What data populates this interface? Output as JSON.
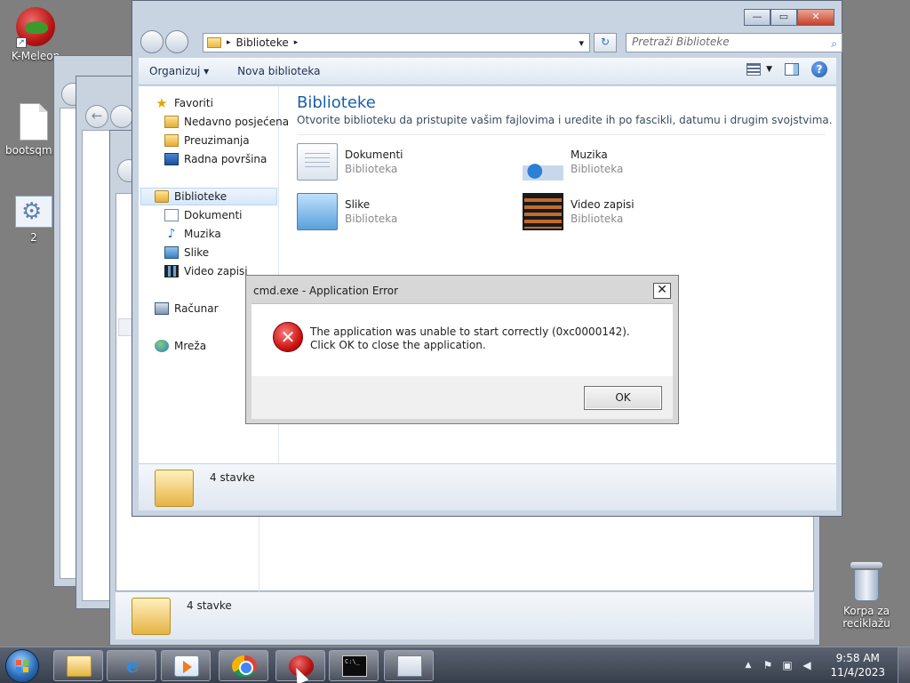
{
  "desktop": {
    "icons": [
      {
        "label": "K-Meleon",
        "icon": "k-meleon-icon"
      },
      {
        "label": "bootsqm.d",
        "icon": "file-icon"
      },
      {
        "label": "2",
        "icon": "setup-icon"
      }
    ],
    "recycle_bin": {
      "label_line1": "Korpa za",
      "label_line2": "reciklažu",
      "icon": "recycle-bin-icon"
    }
  },
  "explorer": {
    "address": {
      "crumb": "Biblioteke",
      "separator": "▸",
      "dropdown": "▾",
      "refresh": "↻"
    },
    "search": {
      "placeholder": "Pretraži Biblioteke",
      "icon": "search-icon"
    },
    "window_controls": {
      "minimize": "—",
      "maximize": "▭",
      "close": "✕"
    },
    "toolbar": {
      "organize": "Organizuj ▾",
      "new_library": "Nova biblioteka",
      "help": "?"
    },
    "nav": {
      "favorites": "Favoriti",
      "recent": "Nedavno posjećena",
      "downloads": "Preuzimanja",
      "desktop": "Radna površina",
      "libraries": "Biblioteke",
      "documents": "Dokumenti",
      "music": "Muzika",
      "pictures": "Slike",
      "videos": "Video zapisi",
      "computer": "Računar",
      "network": "Mreža"
    },
    "main": {
      "title": "Biblioteke",
      "description": "Otvorite biblioteku da pristupite vašim fajlovima i uredite ih po fascikli, datumu i drugim svojstvima.",
      "libraries": [
        {
          "name": "Dokumenti",
          "type": "Biblioteka"
        },
        {
          "name": "Muzika",
          "type": "Biblioteka"
        },
        {
          "name": "Slike",
          "type": "Biblioteka"
        },
        {
          "name": "Video zapisi",
          "type": "Biblioteka"
        }
      ]
    },
    "status": {
      "count": "4 stavke"
    }
  },
  "background_window": {
    "status": {
      "count": "4 stavke"
    },
    "back": "←"
  },
  "dialog": {
    "title": "cmd.exe - Application Error",
    "close": "✕",
    "icon": "error-icon",
    "message": "The application was unable to start correctly (0xc0000142). Click OK to close the application.",
    "ok_label": "OK"
  },
  "taskbar": {
    "pinned": [
      "explorer",
      "internet-explorer",
      "media-player",
      "chrome",
      "k-meleon",
      "cmd",
      "app"
    ],
    "tray": {
      "expand": "▲",
      "time": "9:58 AM",
      "date": "11/4/2023"
    }
  }
}
